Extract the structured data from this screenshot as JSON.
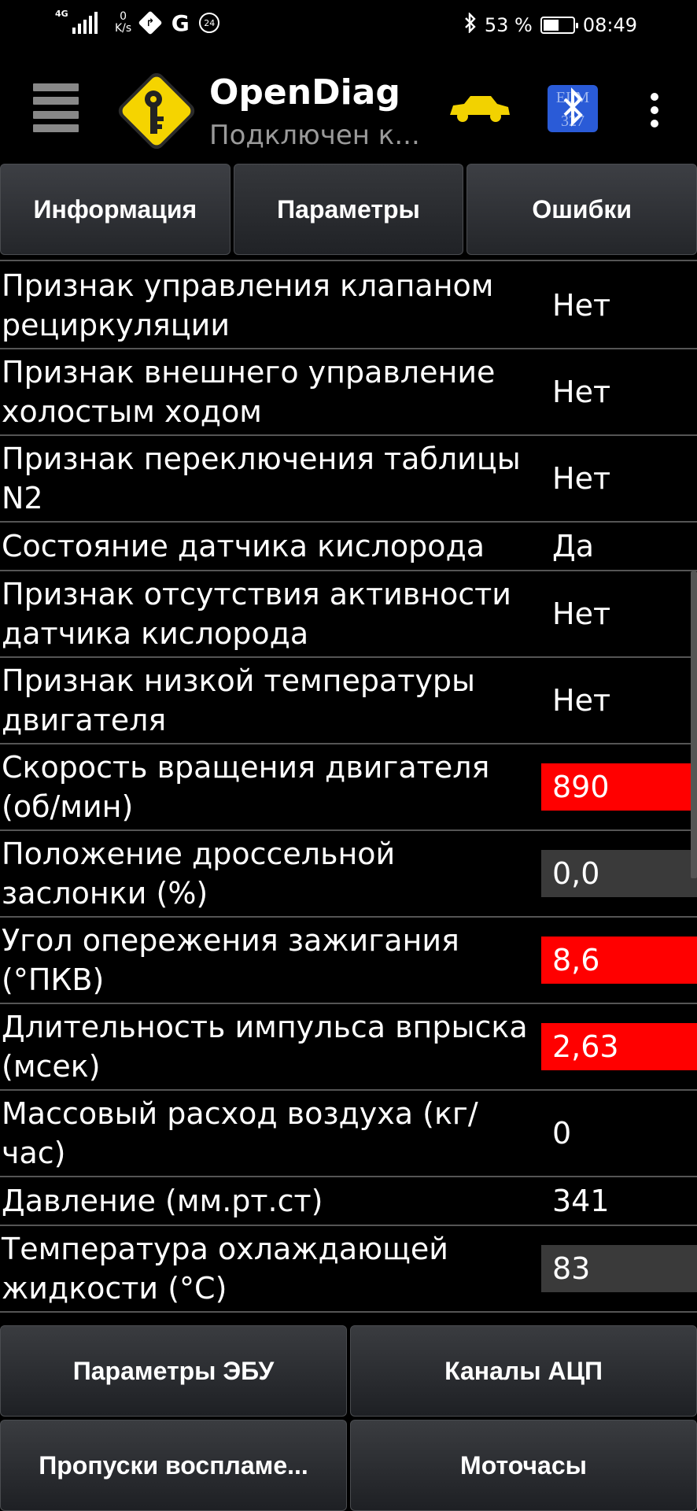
{
  "status_bar": {
    "network_type": "4G",
    "net_speed_value": "0",
    "net_speed_unit": "K/s",
    "badge_24": "24",
    "g_letter": "G",
    "battery_percent": "53 %",
    "time": "08:49"
  },
  "app_bar": {
    "title": "OpenDiag",
    "subtitle": "Подключен к...",
    "bt_label_top": "ELM",
    "bt_label_bottom": "327"
  },
  "tabs": [
    {
      "label": "Информация"
    },
    {
      "label": "Параметры"
    },
    {
      "label": "Ошибки"
    }
  ],
  "parameters": [
    {
      "label": "Признак управления клапаном рециркуляции",
      "value": "Нет",
      "style": "plain"
    },
    {
      "label": "Признак внешнего управление холостым ходом",
      "value": "Нет",
      "style": "plain"
    },
    {
      "label": "Признак переключения таблицы N2",
      "value": "Нет",
      "style": "plain"
    },
    {
      "label": "Состояние датчика кислорода",
      "value": "Да",
      "style": "plain"
    },
    {
      "label": "Признак отсутствия активности датчика кислорода",
      "value": "Нет",
      "style": "plain"
    },
    {
      "label": "Признак низкой температуры двигателя",
      "value": "Нет",
      "style": "plain"
    },
    {
      "label": "Скорость вращения двигателя (об/мин)",
      "value": "890",
      "style": "red"
    },
    {
      "label": "Положение дроссельной заслонки (%)",
      "value": "0,0",
      "style": "gray"
    },
    {
      "label": "Угол опережения зажигания (°ПКВ)",
      "value": "8,6",
      "style": "red"
    },
    {
      "label": "Длительность импульса впрыска (мсек)",
      "value": "2,63",
      "style": "red"
    },
    {
      "label": "Массовый расход воздуха (кг/час)",
      "value": "0",
      "style": "plain"
    },
    {
      "label": "Давление (мм.рт.ст)",
      "value": "341",
      "style": "plain"
    },
    {
      "label": "Температура охлаждающей жидкости (°С)",
      "value": "83",
      "style": "gray"
    }
  ],
  "bottom_buttons": [
    {
      "label": "Параметры ЭБУ"
    },
    {
      "label": "Каналы АЦП"
    },
    {
      "label": "Пропуски воспламе..."
    },
    {
      "label": "Моточасы"
    }
  ],
  "colors": {
    "background": "#000000",
    "value_red": "#ff0000",
    "value_gray": "#3a3a3a",
    "divider": "#555555",
    "logo_yellow": "#f5d400",
    "car_yellow": "#f2d200",
    "bt_blue": "#2a5bd7"
  }
}
